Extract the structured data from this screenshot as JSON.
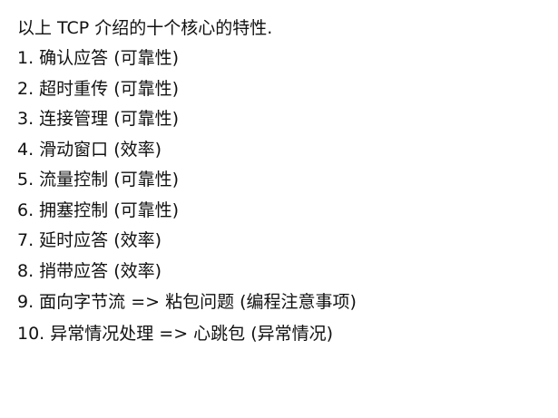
{
  "intro": "以上 TCP 介绍的十个核心的特性.",
  "items": [
    "1. 确认应答 (可靠性)",
    "2. 超时重传 (可靠性)",
    "3. 连接管理 (可靠性)",
    "4. 滑动窗口 (效率)",
    "5. 流量控制 (可靠性)",
    "6. 拥塞控制 (可靠性)",
    "7. 延时应答 (效率)",
    "8. 捎带应答 (效率)",
    "9. 面向字节流 => 粘包问题 (编程注意事项)",
    "10. 异常情况处理 => 心跳包 (异常情况)"
  ]
}
